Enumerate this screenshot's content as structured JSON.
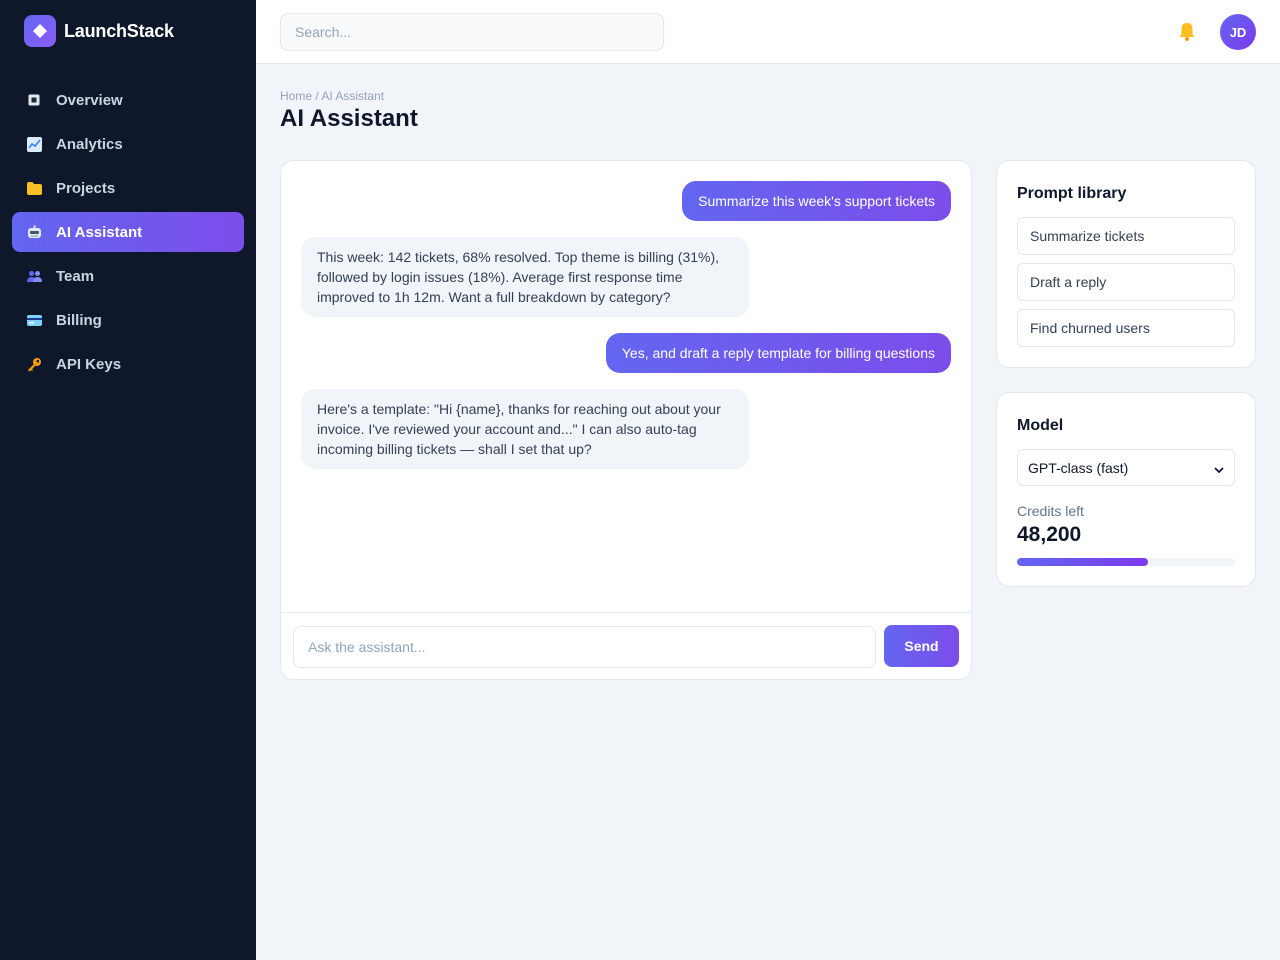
{
  "brand": {
    "name": "LaunchStack"
  },
  "sidebar": {
    "items": [
      {
        "label": "Overview",
        "icon": "overview-icon",
        "active": false
      },
      {
        "label": "Analytics",
        "icon": "chart-icon",
        "active": false
      },
      {
        "label": "Projects",
        "icon": "folder-icon",
        "active": false
      },
      {
        "label": "AI Assistant",
        "icon": "robot-icon",
        "active": true
      },
      {
        "label": "Team",
        "icon": "team-icon",
        "active": false
      },
      {
        "label": "Billing",
        "icon": "credit-card-icon",
        "active": false
      },
      {
        "label": "API Keys",
        "icon": "key-icon",
        "active": false
      }
    ]
  },
  "topbar": {
    "search_placeholder": "Search...",
    "avatar_initials": "JD"
  },
  "header": {
    "breadcrumb": "Home / AI Assistant",
    "title": "AI Assistant"
  },
  "chat": {
    "messages": [
      {
        "role": "user",
        "text": "Summarize this week's support tickets"
      },
      {
        "role": "assistant",
        "text": "This week: 142 tickets, 68% resolved. Top theme is billing (31%), followed by login issues (18%). Average first response time improved to 1h 12m. Want a full breakdown by category?"
      },
      {
        "role": "user",
        "text": "Yes, and draft a reply template for billing questions"
      },
      {
        "role": "assistant",
        "text": "Here's a template: \"Hi {name}, thanks for reaching out about your invoice. I've reviewed your account and...\" I can also auto-tag incoming billing tickets — shall I set that up?"
      }
    ],
    "input_placeholder": "Ask the assistant...",
    "send_label": "Send"
  },
  "prompt_library": {
    "title": "Prompt library",
    "prompts": [
      "Summarize tickets",
      "Draft a reply",
      "Find churned users"
    ]
  },
  "model": {
    "title": "Model",
    "selected": "GPT-class (fast)",
    "credits_label": "Credits left",
    "credits_value": "48,200",
    "credits_fraction": 0.6
  },
  "colors": {
    "sidebar_bg": "#0f172a",
    "accent_start": "#6366f1",
    "accent_end": "#7c3aed",
    "page_bg": "#f1f4f8"
  }
}
